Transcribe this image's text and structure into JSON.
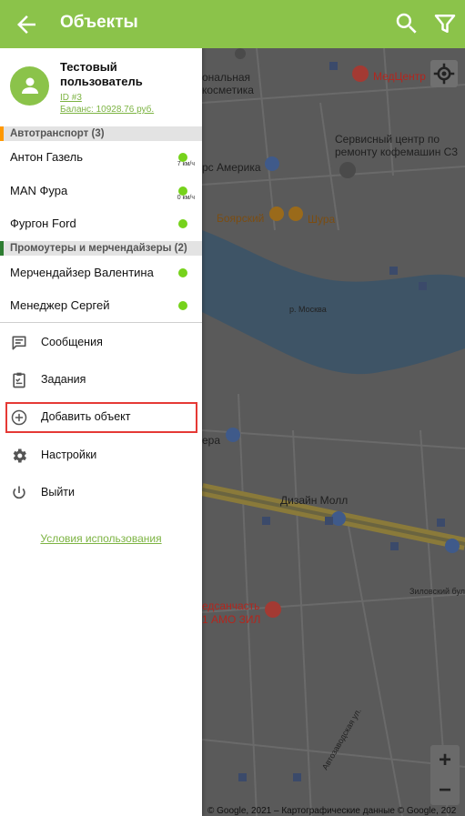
{
  "appbar": {
    "title": "Объекты",
    "back_icon": "arrow-back-icon",
    "search_icon": "search-icon",
    "filter_icon": "filter-icon",
    "color": "#8bc34a"
  },
  "user": {
    "name": "Тестовый пользователь",
    "id": "ID #3",
    "balance": "Баланс: 10928.76 руб."
  },
  "groups": [
    {
      "label": "Автотранспорт (3)",
      "color": "#ff9800",
      "items": [
        {
          "name": "Антон Газель",
          "speed": "7 км/ч",
          "status_color": "#76d21b"
        },
        {
          "name": "MAN Фура",
          "speed": "0 км/ч",
          "status_color": "#76d21b"
        },
        {
          "name": "Фургон Ford",
          "speed": "",
          "status_color": "#76d21b"
        }
      ]
    },
    {
      "label": "Промоутеры и мерчендайзеры (2)",
      "color": "#2e7d32",
      "items": [
        {
          "name": "Мерчендайзер Валентина",
          "speed": "",
          "status_color": "#76d21b"
        },
        {
          "name": "Менеджер Сергей",
          "speed": "",
          "status_color": "#76d21b"
        }
      ]
    }
  ],
  "menu": [
    {
      "label": "Сообщения",
      "icon": "message-icon"
    },
    {
      "label": "Задания",
      "icon": "clipboard-icon"
    },
    {
      "label": "Добавить объект",
      "icon": "add-circle-icon"
    },
    {
      "label": "Настройки",
      "icon": "gear-icon"
    },
    {
      "label": "Выйти",
      "icon": "power-icon"
    }
  ],
  "terms_link": "Условия использования",
  "map": {
    "labels": {
      "cosmetics_1": "ональная",
      "cosmetics_2": "косметика",
      "medcenter": "МедЦентр",
      "service_1": "Сервисный центр по",
      "service_2": "ремонту кофемашин С3",
      "america": "рс Америка",
      "boyarsky": "Боярский",
      "shura": "Шура",
      "river": "р. Москва",
      "era": "ера",
      "design_mall": "Дизайн Молл",
      "zilovsky": "Зиловский бул.",
      "medsanchast_1": "едсанчасть",
      "medsanchast_2": "1 АМО ЗИЛ",
      "avtozavodskaya": "Автозаводская ул.",
      "credit": "© Google, 2021 – Картографические данные © Google, 202"
    },
    "zoom_in": "+",
    "zoom_out": "−"
  }
}
